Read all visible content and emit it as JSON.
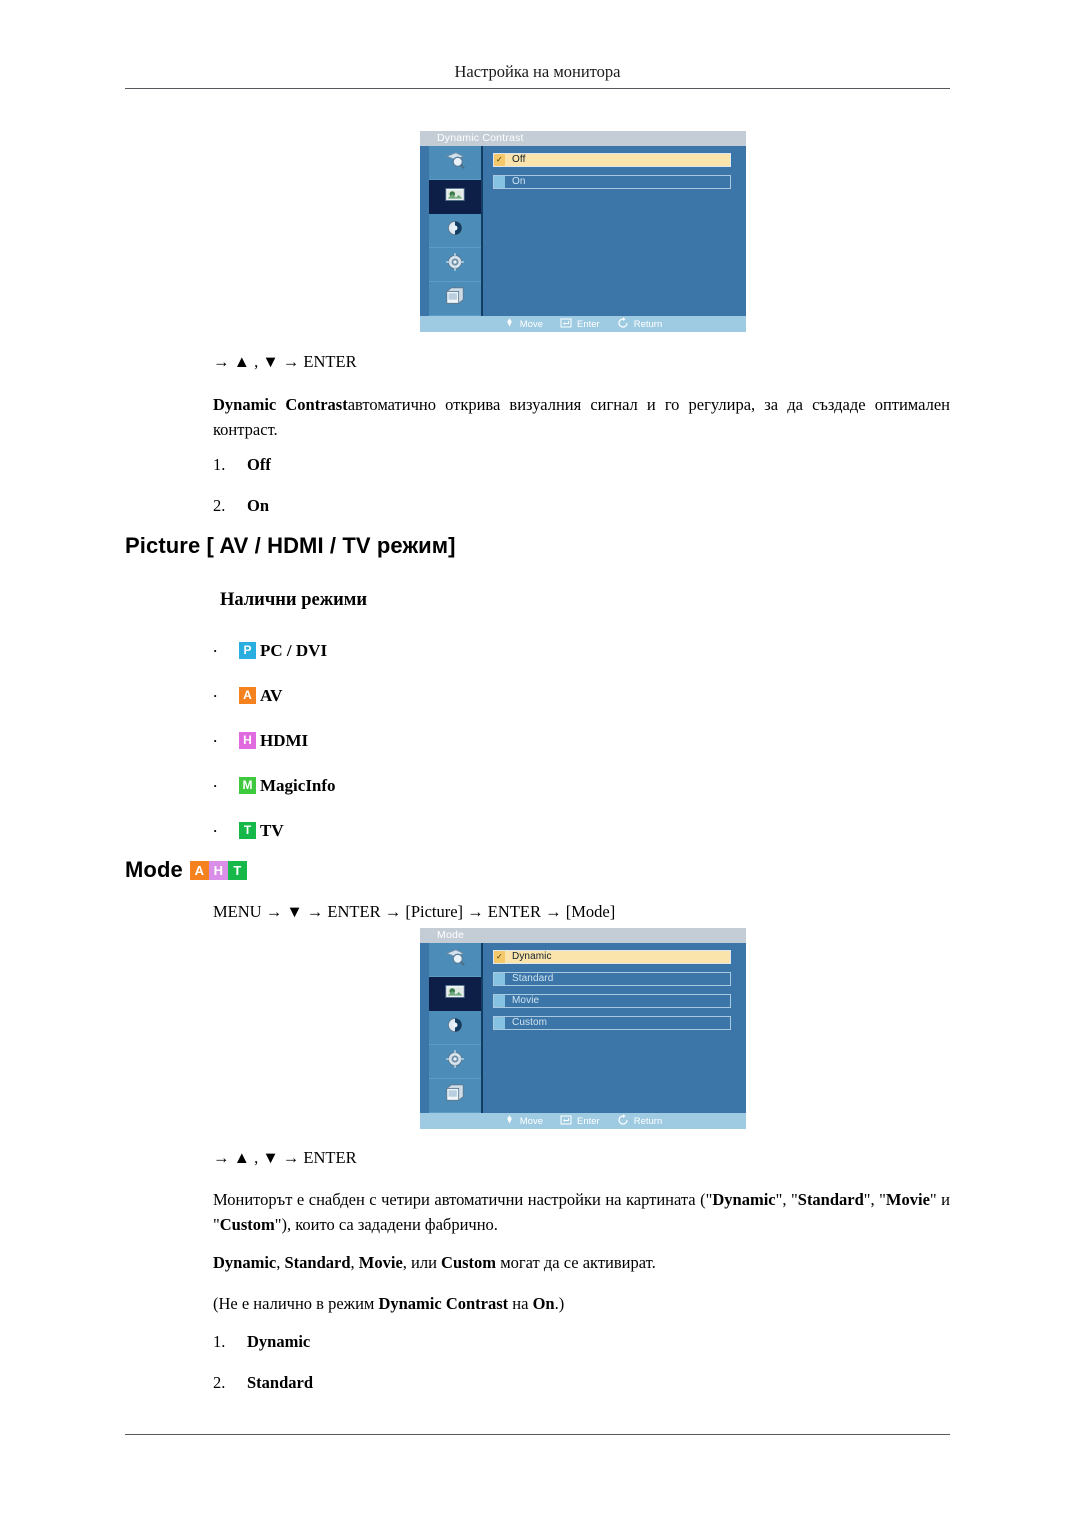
{
  "page": {
    "running_header": "Настройка на монитора"
  },
  "osd_dynamic_contrast": {
    "title": "Dynamic Contrast",
    "sidebar_icons": [
      "input-source-icon",
      "picture-icon",
      "sound-icon",
      "setup-icon",
      "multi-control-icon"
    ],
    "active_sidebar_index": 1,
    "options": [
      {
        "label": "Off",
        "selected": true
      },
      {
        "label": "On",
        "selected": false
      }
    ],
    "footer": [
      {
        "icon": "move-diamond-icon",
        "label": "Move"
      },
      {
        "icon": "enter-key-icon",
        "label": "Enter"
      },
      {
        "icon": "return-arrow-icon",
        "label": "Return"
      }
    ]
  },
  "section_dynamic_contrast": {
    "keyline": "→ ▲ , ▼ → ENTER",
    "paragraph_bold": "Dynamic Contrast",
    "paragraph_rest": "автоматично открива визуалния сигнал и го регулира, за да създаде оптимален контраст.",
    "items": [
      {
        "num": "1.",
        "text": "Off"
      },
      {
        "num": "2.",
        "text": "On"
      }
    ]
  },
  "picture_section": {
    "heading": "Picture [ AV / HDMI / TV режим]",
    "subheading": "Налични режими",
    "modes": [
      {
        "letter": "P",
        "color": "#2aaee0",
        "label": "PC / DVI"
      },
      {
        "letter": "A",
        "color": "#f5821f",
        "label": "AV"
      },
      {
        "letter": "H",
        "color": "#e06ae0",
        "label": "HDMI"
      },
      {
        "letter": "M",
        "color": "#3ec93e",
        "label": "MagicInfo"
      },
      {
        "letter": "T",
        "color": "#17b84a",
        "label": "TV"
      }
    ]
  },
  "mode_section": {
    "heading": "Mode",
    "heading_chips": [
      {
        "letter": "A",
        "color": "#f5821f"
      },
      {
        "letter": "H",
        "color": "#d98fe8"
      },
      {
        "letter": "T",
        "color": "#17b84a"
      }
    ],
    "nav_path": "MENU → ▼ → ENTER → [Picture] → ENTER → [Mode]",
    "keyline": "→ ▲ , ▼ → ENTER",
    "paragraph1_a": "Мониторът е снабден с четири автоматични настройки на картината (\"",
    "paragraph1_b1": "Dynamic",
    "paragraph1_c": "\", \"",
    "paragraph1_b2": "Standard",
    "paragraph1_d": "\", \"",
    "paragraph1_b3": "Movie",
    "paragraph1_e": "\" и \"",
    "paragraph1_b4": "Custom",
    "paragraph1_f": "\"), които са зададени фабрично.",
    "paragraph2_b1": "Dynamic",
    "paragraph2_s1": ", ",
    "paragraph2_b2": "Standard",
    "paragraph2_s2": ", ",
    "paragraph2_b3": "Movie",
    "paragraph2_s3": ", или ",
    "paragraph2_b4": "Custom",
    "paragraph2_s4": " могат да се активират.",
    "paragraph3_a": "(Не е налично в режим ",
    "paragraph3_b1": "Dynamic Contrast",
    "paragraph3_c": " на ",
    "paragraph3_b2": "On",
    "paragraph3_d": ".)",
    "items": [
      {
        "num": "1.",
        "text": "Dynamic"
      },
      {
        "num": "2.",
        "text": "Standard"
      }
    ]
  },
  "osd_mode": {
    "title": "Mode",
    "sidebar_icons": [
      "input-source-icon",
      "picture-icon",
      "sound-icon",
      "setup-icon",
      "multi-control-icon"
    ],
    "active_sidebar_index": 1,
    "options": [
      {
        "label": "Dynamic",
        "selected": true
      },
      {
        "label": "Standard",
        "selected": false
      },
      {
        "label": "Movie",
        "selected": false
      },
      {
        "label": "Custom",
        "selected": false
      }
    ],
    "footer": [
      {
        "icon": "move-diamond-icon",
        "label": "Move"
      },
      {
        "icon": "enter-key-icon",
        "label": "Enter"
      },
      {
        "icon": "return-arrow-icon",
        "label": "Return"
      }
    ]
  }
}
